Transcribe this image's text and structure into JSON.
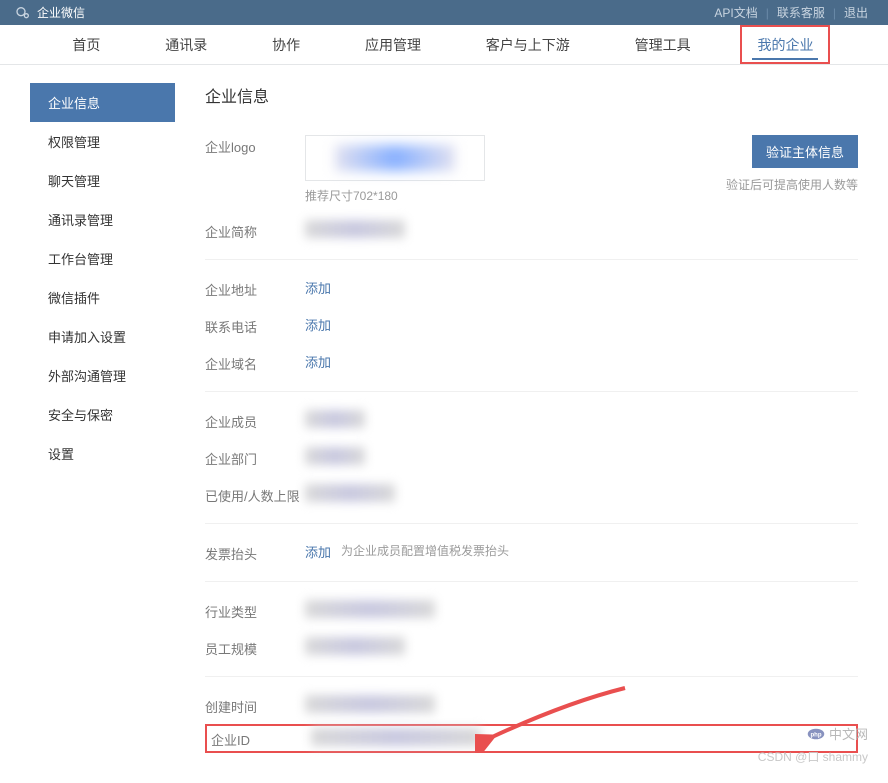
{
  "header": {
    "brand": "企业微信",
    "links": {
      "api_docs": "API文档",
      "contact": "联系客服",
      "logout": "退出"
    }
  },
  "nav": {
    "items": [
      {
        "label": "首页"
      },
      {
        "label": "通讯录"
      },
      {
        "label": "协作"
      },
      {
        "label": "应用管理"
      },
      {
        "label": "客户与上下游"
      },
      {
        "label": "管理工具"
      },
      {
        "label": "我的企业"
      }
    ]
  },
  "sidebar": {
    "items": [
      {
        "label": "企业信息"
      },
      {
        "label": "权限管理"
      },
      {
        "label": "聊天管理"
      },
      {
        "label": "通讯录管理"
      },
      {
        "label": "工作台管理"
      },
      {
        "label": "微信插件"
      },
      {
        "label": "申请加入设置"
      },
      {
        "label": "外部沟通管理"
      },
      {
        "label": "安全与保密"
      },
      {
        "label": "设置"
      }
    ]
  },
  "content": {
    "title": "企业信息",
    "logo_label": "企业logo",
    "logo_hint": "推荐尺寸702*180",
    "shortname_label": "企业简称",
    "verify_button": "验证主体信息",
    "verify_hint": "验证后可提高使用人数等",
    "address_label": "企业地址",
    "phone_label": "联系电话",
    "domain_label": "企业域名",
    "add_action": "添加",
    "members_label": "企业成员",
    "departments_label": "企业部门",
    "usage_label": "已使用/人数上限",
    "invoice_label": "发票抬头",
    "invoice_hint": "为企业成员配置增值税发票抬头",
    "industry_label": "行业类型",
    "scale_label": "员工规模",
    "created_label": "创建时间",
    "corp_id_label": "企业ID"
  },
  "watermark": {
    "php": "中文网",
    "csdn": "CSDN @口 shammy"
  }
}
